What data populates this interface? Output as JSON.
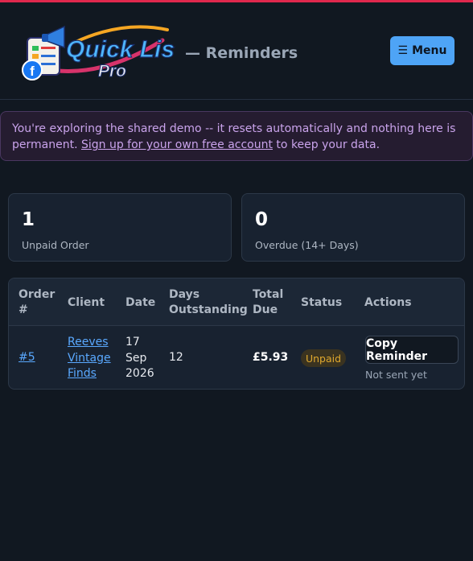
{
  "header": {
    "logo_text_top": "Quick List",
    "logo_text_bottom": "Pro",
    "title": "— Reminders",
    "menu_label": "Menu",
    "menu_icon": "hamburger-icon"
  },
  "banner": {
    "text_before": "You're exploring the shared demo -- it resets automatically and nothing here is permanent. ",
    "link_text": "Sign up for your own free account",
    "text_after": " to keep your data."
  },
  "stats": [
    {
      "value": "1",
      "label": "Unpaid Order"
    },
    {
      "value": "0",
      "label": "Overdue (14+ Days)"
    }
  ],
  "table": {
    "headers": {
      "order_1": "Order",
      "order_2": "#",
      "client": "Client",
      "date": "Date",
      "days_1": "Days",
      "days_2": "Outstanding",
      "total_1": "Total",
      "total_2": "Due",
      "status": "Status",
      "actions": "Actions"
    },
    "rows": [
      {
        "order": "#5",
        "client_1": "Reeves",
        "client_2": "Vintage",
        "client_3": "Finds",
        "date_1": "17",
        "date_2": "Sep",
        "date_3": "2026",
        "days": "12",
        "total": "£5.93",
        "status": "Unpaid",
        "action_label": "Copy Reminder",
        "action_note": "Not sent yet"
      }
    ]
  },
  "colors": {
    "accent": "#e0284d",
    "menu_button": "#4ea4f6",
    "link": "#5aa9ff",
    "status_unpaid": "#e0a92e",
    "banner_text": "#c9a3eb"
  }
}
